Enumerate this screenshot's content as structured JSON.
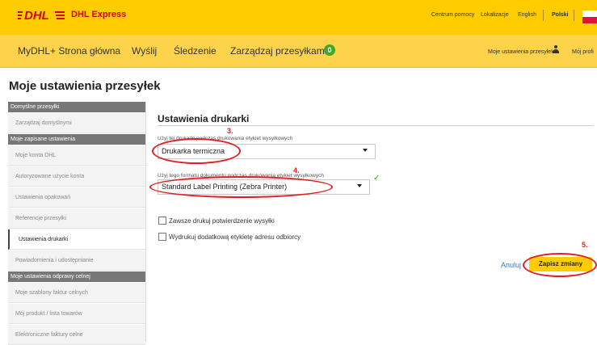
{
  "header": {
    "brand_text": "DHL Express",
    "logo_text": "DHL",
    "links": {
      "help": "Centrum pomocy",
      "locations": "Lokalizacje",
      "english": "English",
      "polish": "Polski"
    },
    "colors": {
      "brand_yellow": "#ffcc00",
      "brand_red": "#d40511"
    }
  },
  "navbar": {
    "items": [
      "MyDHL+ Strona główna",
      "Wyślij",
      "Śledzenie",
      "Zarządzaj przesyłkami"
    ],
    "badge": "0",
    "right_link": "Moje ustawienia przesyłek",
    "user_link": "Mój profi"
  },
  "page": {
    "title": "Moje ustawienia przesyłek"
  },
  "sidebar": {
    "heads": [
      "Domyślne przesyłki",
      "Moje zapisane ustawienia",
      "Moje ustawienia odprawy celnej"
    ],
    "items": [
      "Zarządzaj domyślnymi",
      "Moje konta DHL",
      "Autoryzowane użycie konta",
      "Ustawienia opakowań",
      "Referencje przesyłki",
      "Ustawienia drukarki",
      "Powiadomienia i udostępnianie",
      "Moje szablony faktur celnych",
      "Mój produkt / lista towarów",
      "Elektroniczne faktury celne"
    ]
  },
  "main": {
    "section_title": "Ustawienia drukarki",
    "printer_label": "Użyj tej drukarki podczas drukowania etykiet wysyłkowych",
    "printer_value": "Drukarka termiczna",
    "format_label": "Użyj tego formatu dokumentu podczas drukowania etykiet wysyłkowych",
    "format_value": "Standard Label Printing (Zebra Printer)",
    "checkbox1": "Zawsze drukuj potwierdzenie wysyłki",
    "checkbox2": "Wydrukuj dodatkową etykietę adresu odbiorcy",
    "cancel": "Anuluj",
    "save": "Zapisz zmiany"
  },
  "annotations": [
    "3.",
    "4.",
    "5."
  ]
}
